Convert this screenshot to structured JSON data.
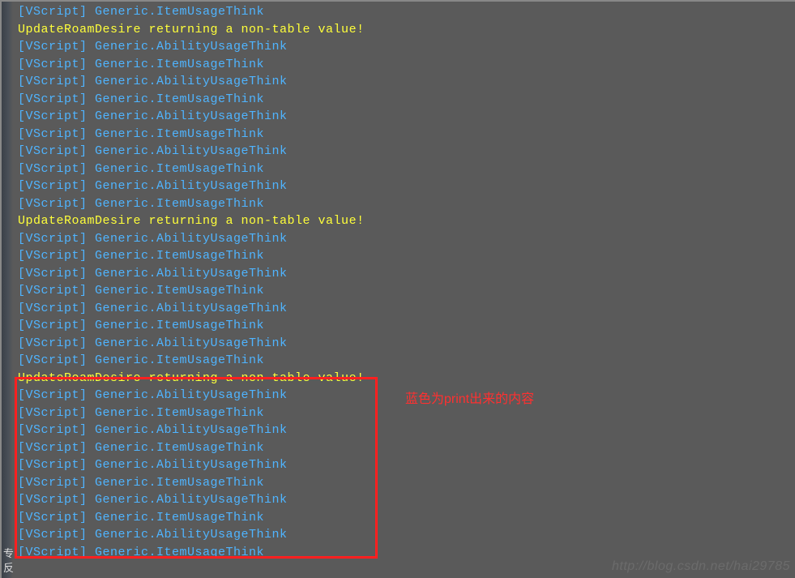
{
  "lines": [
    {
      "type": "blue",
      "prefix": "[VScript]",
      "msg": "Generic.ItemUsageThink"
    },
    {
      "type": "warn",
      "msg": "UpdateRoamDesire returning a non-table value!"
    },
    {
      "type": "blue",
      "prefix": "[VScript]",
      "msg": "Generic.AbilityUsageThink"
    },
    {
      "type": "blue",
      "prefix": "[VScript]",
      "msg": "Generic.ItemUsageThink"
    },
    {
      "type": "blue",
      "prefix": "[VScript]",
      "msg": "Generic.AbilityUsageThink"
    },
    {
      "type": "blue",
      "prefix": "[VScript]",
      "msg": "Generic.ItemUsageThink"
    },
    {
      "type": "blue",
      "prefix": "[VScript]",
      "msg": "Generic.AbilityUsageThink"
    },
    {
      "type": "blue",
      "prefix": "[VScript]",
      "msg": "Generic.ItemUsageThink"
    },
    {
      "type": "blue",
      "prefix": "[VScript]",
      "msg": "Generic.AbilityUsageThink"
    },
    {
      "type": "blue",
      "prefix": "[VScript]",
      "msg": "Generic.ItemUsageThink"
    },
    {
      "type": "blue",
      "prefix": "[VScript]",
      "msg": "Generic.AbilityUsageThink"
    },
    {
      "type": "blue",
      "prefix": "[VScript]",
      "msg": "Generic.ItemUsageThink"
    },
    {
      "type": "warn",
      "msg": "UpdateRoamDesire returning a non-table value!"
    },
    {
      "type": "blue",
      "prefix": "[VScript]",
      "msg": "Generic.AbilityUsageThink"
    },
    {
      "type": "blue",
      "prefix": "[VScript]",
      "msg": "Generic.ItemUsageThink"
    },
    {
      "type": "blue",
      "prefix": "[VScript]",
      "msg": "Generic.AbilityUsageThink"
    },
    {
      "type": "blue",
      "prefix": "[VScript]",
      "msg": "Generic.ItemUsageThink"
    },
    {
      "type": "blue",
      "prefix": "[VScript]",
      "msg": "Generic.AbilityUsageThink"
    },
    {
      "type": "blue",
      "prefix": "[VScript]",
      "msg": "Generic.ItemUsageThink"
    },
    {
      "type": "blue",
      "prefix": "[VScript]",
      "msg": "Generic.AbilityUsageThink"
    },
    {
      "type": "blue",
      "prefix": "[VScript]",
      "msg": "Generic.ItemUsageThink"
    },
    {
      "type": "warn",
      "msg": "UpdateRoamDesire returning a non-table value!"
    },
    {
      "type": "blue",
      "prefix": "[VScript]",
      "msg": "Generic.AbilityUsageThink"
    },
    {
      "type": "blue",
      "prefix": "[VScript]",
      "msg": "Generic.ItemUsageThink"
    },
    {
      "type": "blue",
      "prefix": "[VScript]",
      "msg": "Generic.AbilityUsageThink"
    },
    {
      "type": "blue",
      "prefix": "[VScript]",
      "msg": "Generic.ItemUsageThink"
    },
    {
      "type": "blue",
      "prefix": "[VScript]",
      "msg": "Generic.AbilityUsageThink"
    },
    {
      "type": "blue",
      "prefix": "[VScript]",
      "msg": "Generic.ItemUsageThink"
    },
    {
      "type": "blue",
      "prefix": "[VScript]",
      "msg": "Generic.AbilityUsageThink"
    },
    {
      "type": "blue",
      "prefix": "[VScript]",
      "msg": "Generic.ItemUsageThink"
    },
    {
      "type": "blue",
      "prefix": "[VScript]",
      "msg": "Generic.AbilityUsageThink"
    },
    {
      "type": "blue",
      "prefix": "[VScript]",
      "msg": "Generic.ItemUsageThink"
    }
  ],
  "annotation": "蓝色为print出来的内容",
  "watermark": "http://blog.csdn.net/hai29785",
  "edge1": "专",
  "edge2": "反"
}
